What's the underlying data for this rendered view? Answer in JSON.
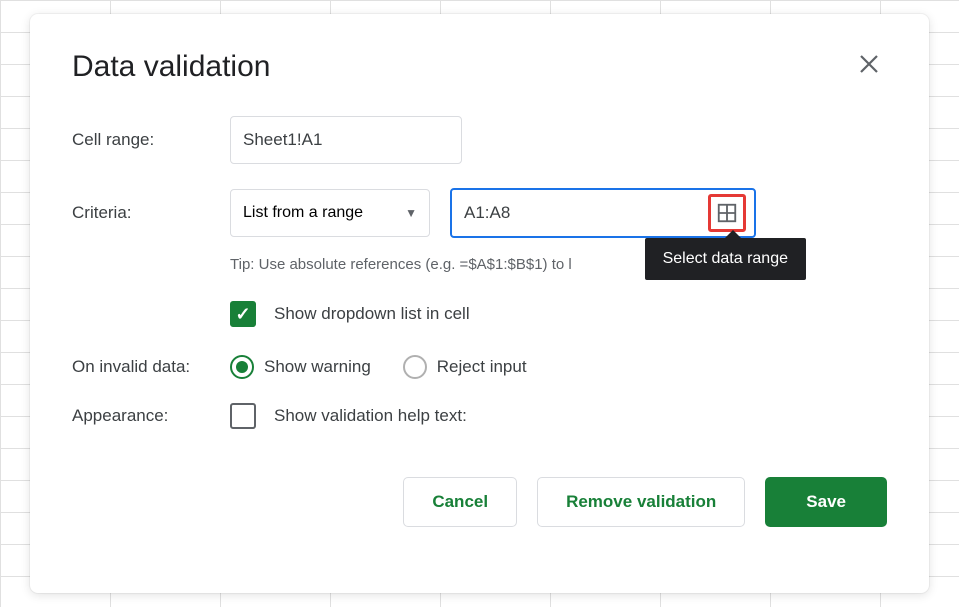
{
  "dialog": {
    "title": "Data validation",
    "cellRange": {
      "label": "Cell range:",
      "value": "Sheet1!A1"
    },
    "criteria": {
      "label": "Criteria:",
      "dropdown": "List from a range",
      "rangeValue": "A1:A8",
      "tip": "Tip: Use absolute references (e.g. =$A$1:$B$1) to l",
      "tooltip": "Select data range",
      "showDropdownLabel": "Show dropdown list in cell"
    },
    "onInvalidData": {
      "label": "On invalid data:",
      "warning": "Show warning",
      "reject": "Reject input"
    },
    "appearance": {
      "label": "Appearance:",
      "helpTextLabel": "Show validation help text:"
    },
    "buttons": {
      "cancel": "Cancel",
      "remove": "Remove validation",
      "save": "Save"
    }
  }
}
